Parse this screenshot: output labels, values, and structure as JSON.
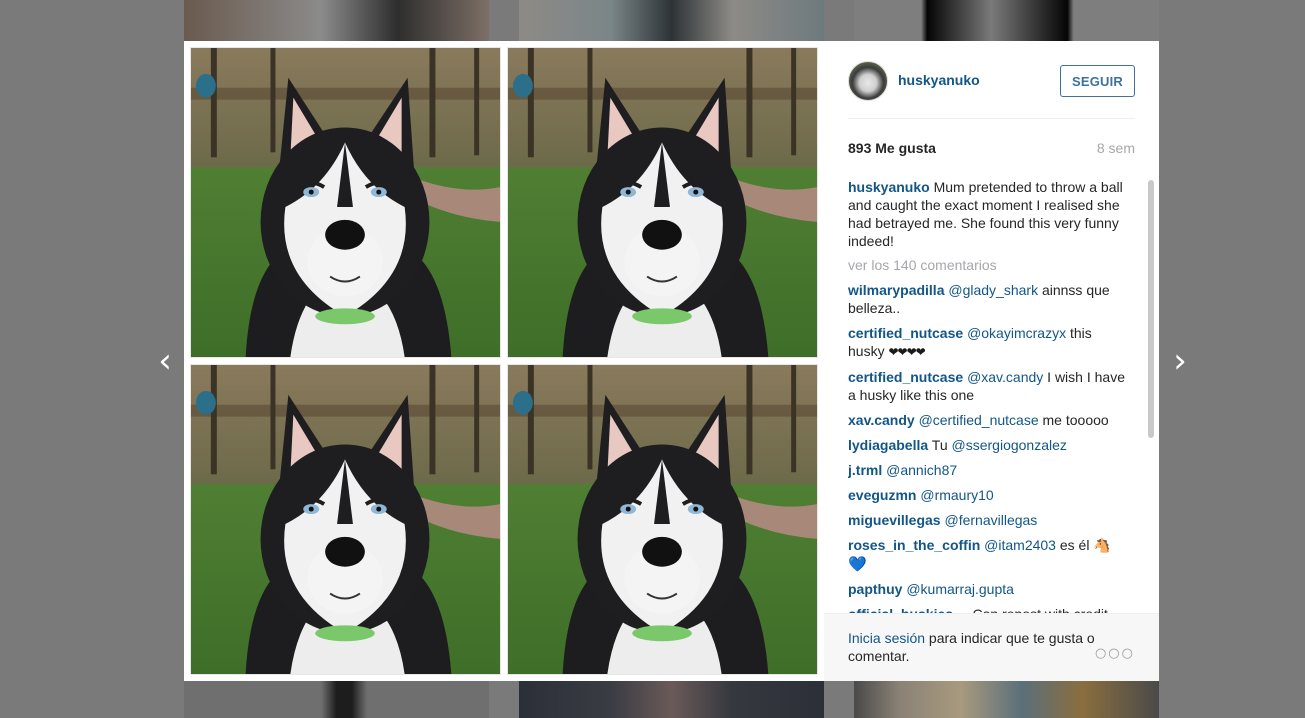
{
  "post": {
    "username": "huskyanuko",
    "follow_label": "SEGUIR",
    "likes": "893 Me gusta",
    "age": "8 sem",
    "caption": "Mum pretended to throw a ball and caught the exact moment I realised she had betrayed me. She found this very funny indeed!",
    "view_all": "ver los 140 comentarios"
  },
  "comments": [
    {
      "user": "wilmarypadilla",
      "mention": "@glady_shark",
      "text": " ainnss que belleza.."
    },
    {
      "user": "certified_nutcase",
      "mention": "@okayimcrazyx",
      "text": " this husky ",
      "emoji": "❤❤❤❤"
    },
    {
      "user": "certified_nutcase",
      "mention": "@xav.candy",
      "text": " I wish I have a husky like this one"
    },
    {
      "user": "xav.candy",
      "mention": "@certified_nutcase",
      "text": " me tooooo"
    },
    {
      "user": "lydiagabella",
      "pre": " Tu ",
      "mention": "@ssergiogonzalez",
      "text": ""
    },
    {
      "user": "j.trml",
      "mention": "@annich87",
      "text": ""
    },
    {
      "user": "eveguzmn",
      "mention": "@rmaury10",
      "text": ""
    },
    {
      "user": "miguevillegas",
      "mention": "@fernavillegas",
      "text": ""
    },
    {
      "user": "roses_in_the_coffin",
      "mention": "@itam2403",
      "text": " es él ",
      "emoji": "🐴",
      "emoji2": "💙"
    },
    {
      "user": "papthuy",
      "mention": "@kumarraj.gupta",
      "text": ""
    },
    {
      "user": "official_huskies",
      "mention": "",
      "text": " ... Can repost with credit"
    }
  ],
  "footer": {
    "login_link": "Inicia sesión",
    "login_rest": " para indicar que te gusta o comentar.",
    "more": "○○○"
  },
  "nav": {
    "prev": "‹",
    "next": "›"
  }
}
